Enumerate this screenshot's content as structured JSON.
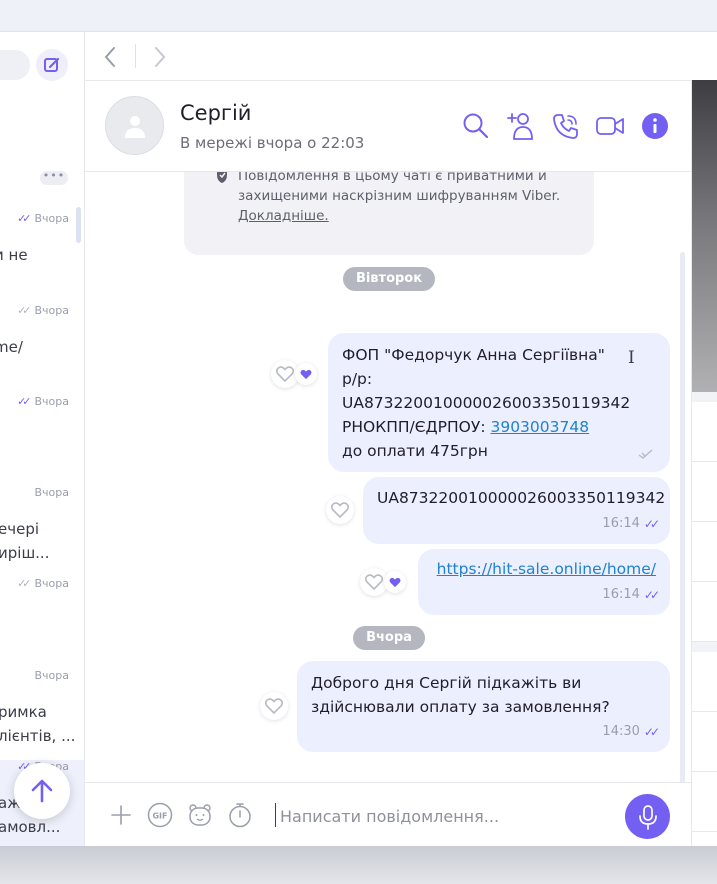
{
  "sidebar": {
    "more_label": "•••",
    "chats": [
      {
        "time": "Вчора",
        "ticks": "✓✓",
        "preview": [
          "и не"
        ]
      },
      {
        "time": "Вчора",
        "ticks": "✓✓",
        "preview": [
          "me/"
        ]
      },
      {
        "time": "Вчора",
        "ticks": "✓✓",
        "preview": []
      },
      {
        "time": "Вчора",
        "ticks": "",
        "preview": [
          "ечері",
          "иріш..."
        ]
      },
      {
        "time": "Вчора",
        "ticks": "✓✓",
        "preview": []
      },
      {
        "time": "Вчора",
        "ticks": "",
        "preview": [
          "римка",
          "лієнтів, ..."
        ]
      },
      {
        "time": "Вчора",
        "ticks": "✓✓",
        "preview": [
          "аж",
          "амовл..."
        ]
      }
    ]
  },
  "header": {
    "name": "Сергій",
    "status": "В мережі вчора о 22:03"
  },
  "encryption": {
    "text": "Повідомлення в цьому чаті є приватними й захищеними наскрізним шифруванням Viber.",
    "link": "Докладніше."
  },
  "dates": {
    "first": "Вівторок",
    "second": "Вчора"
  },
  "messages": {
    "m1": {
      "line1": "ФОП \"Федорчук Анна Сергіївна\"",
      "line2": "р/р: UA873220010000026003350119342",
      "line3_prefix": "РНОКПП/ЄДРПОУ: ",
      "line3_link": "3903003748",
      "line4": "до оплати 475грн"
    },
    "m2": {
      "text": "UA873220010000026003350119342",
      "time": "16:14"
    },
    "m3": {
      "link": "https://hit-sale.online/home/",
      "time": "16:14"
    },
    "m4": {
      "line1": "Доброго дня Сергій підкажіть ви",
      "line2": "здійснювали оплату за замовлення?",
      "time": "14:30"
    }
  },
  "composer": {
    "placeholder": "Написати повідомлення..."
  },
  "colors": {
    "accent": "#7360f2",
    "bubble": "#eceffd",
    "link": "#1f82d2"
  }
}
